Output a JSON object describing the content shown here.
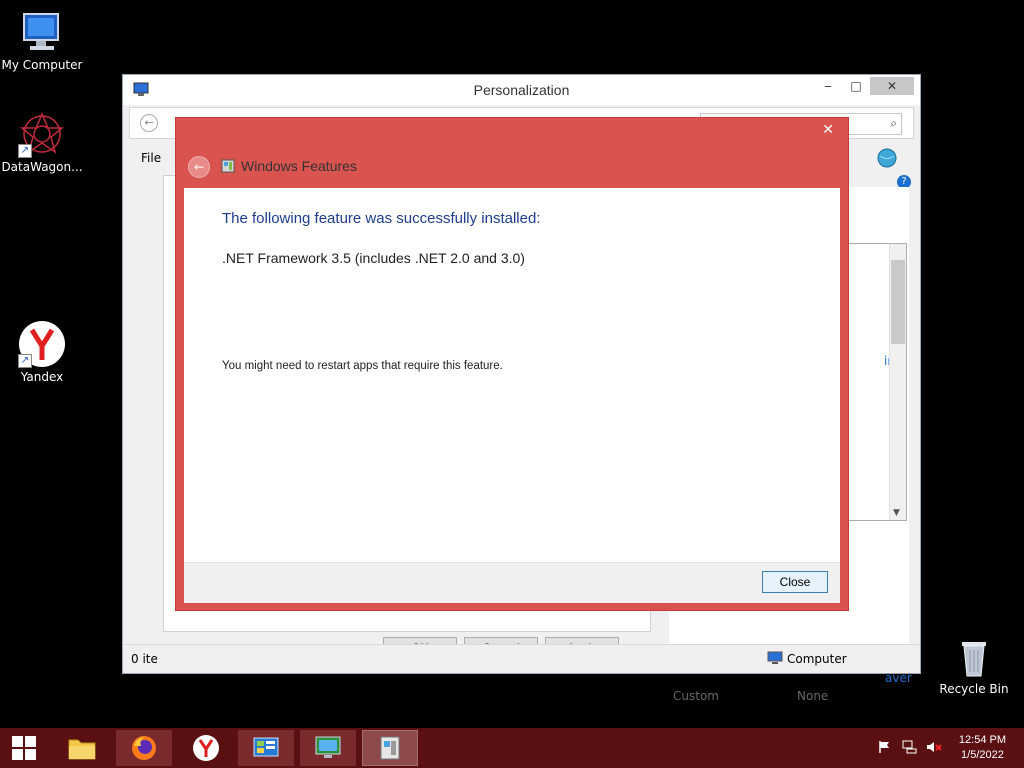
{
  "desktop": {
    "icons": [
      {
        "label": "My Computer"
      },
      {
        "label": "DataWagon..."
      },
      {
        "label": "Yandex"
      },
      {
        "label": "Recycle Bin"
      }
    ]
  },
  "personalization": {
    "title": "Personalization",
    "menu_file": "File",
    "status_left": "0 ite",
    "status_right": "Computer",
    "buttons": {
      "ok": "OK",
      "cancel": "Cancel",
      "apply": "Apply"
    },
    "right_link": "ine",
    "right_caption": "aver",
    "captions": {
      "custom": "Custom",
      "none": "None"
    },
    "minimize_glyph": "‒",
    "maximize_glyph": "□",
    "close_glyph": "✕"
  },
  "windows_features": {
    "title": "Windows Features",
    "heading": "The following feature was successfully installed:",
    "feature": ".NET Framework 3.5 (includes .NET 2.0 and 3.0)",
    "note": "You might need to restart apps that require this feature.",
    "close_label": "Close",
    "close_glyph": "✕",
    "back_glyph": "←"
  },
  "taskbar": {
    "time": "12:54 PM",
    "date": "1/5/2022"
  },
  "colors": {
    "dialog_accent": "#d9534f",
    "taskbar": "#5a1012",
    "heading_text": "#1e3d8f"
  }
}
